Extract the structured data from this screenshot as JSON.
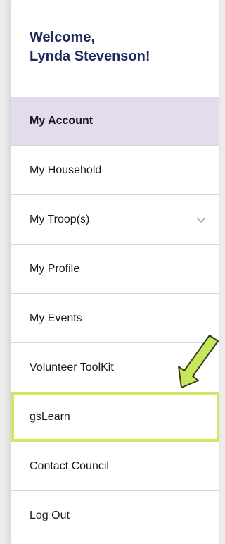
{
  "welcome": {
    "line1": "Welcome,",
    "line2": "Lynda Stevenson!"
  },
  "menu": {
    "items": [
      {
        "label": "My Account",
        "active": true
      },
      {
        "label": "My Household"
      },
      {
        "label": "My Troop(s)",
        "icon": "chevron-down-icon"
      },
      {
        "label": "My Profile"
      },
      {
        "label": "My Events"
      },
      {
        "label": "Volunteer ToolKit"
      },
      {
        "label": "gsLearn",
        "highlighted": true
      },
      {
        "label": "Contact Council"
      },
      {
        "label": "Log Out"
      }
    ]
  },
  "colors": {
    "active_bg": "#e4dcee",
    "heading": "#1d2a5c",
    "highlight": "#cbea62",
    "arrow": "#c4e85a"
  }
}
